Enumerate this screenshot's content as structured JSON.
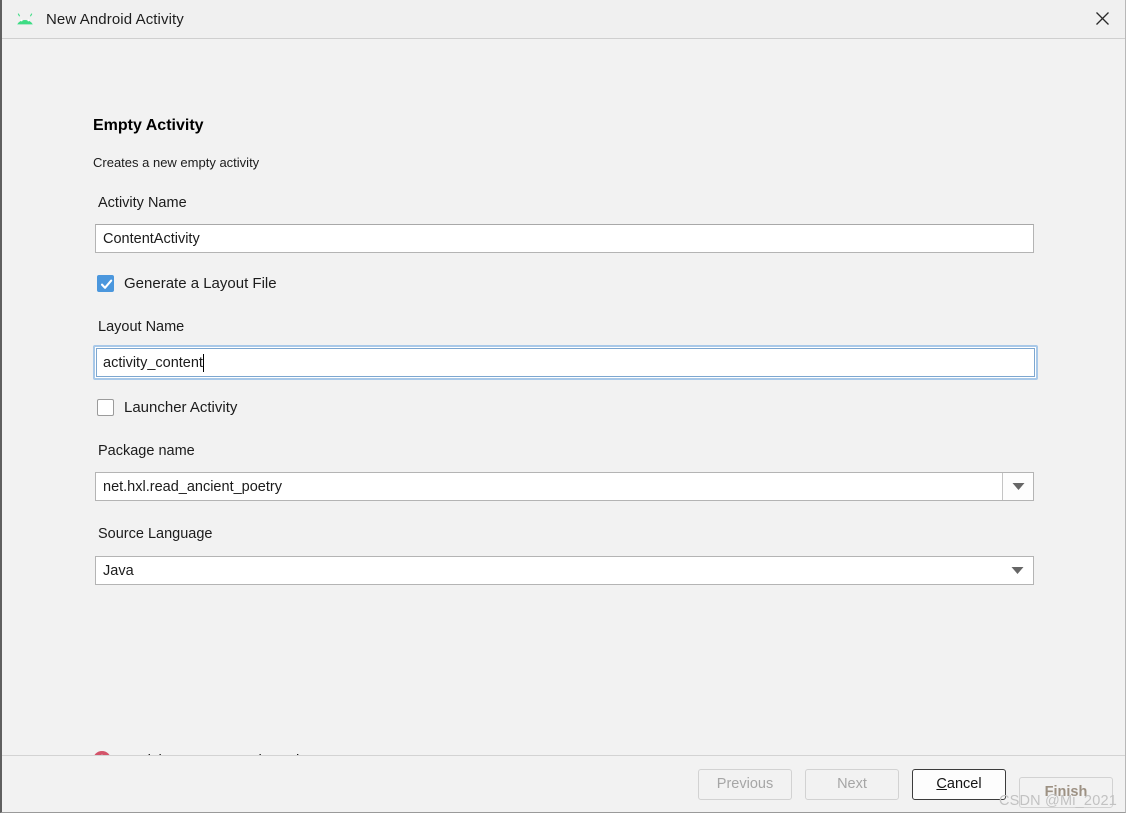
{
  "window": {
    "title": "New Android Activity",
    "app_icon": "android-robot-icon",
    "close_icon": "close-icon"
  },
  "header": {
    "title": "Empty Activity",
    "subtitle": "Creates a new empty activity"
  },
  "fields": {
    "activity_name": {
      "label": "Activity Name",
      "value": "ContentActivity",
      "focused": false
    },
    "generate_layout": {
      "label": "Generate a Layout File",
      "checked": true
    },
    "layout_name": {
      "label": "Layout Name",
      "value": "activity_content",
      "focused": true
    },
    "launcher_activity": {
      "label": "Launcher Activity",
      "checked": false
    },
    "package_name": {
      "label": "Package name",
      "value": "net.hxl.read_ancient_poetry",
      "dropdown_icon": "chevron-down-icon"
    },
    "source_language": {
      "label": "Source Language",
      "value": "Java",
      "dropdown_icon": "chevron-down-icon"
    }
  },
  "validation": {
    "icon": "error-circle-icon",
    "message": "Activity Name must be unique",
    "color": "#d3546a"
  },
  "footer": {
    "buttons": [
      {
        "label": "Previous",
        "state": "disabled"
      },
      {
        "label": "Next",
        "state": "disabled"
      },
      {
        "label": "Cancel",
        "state": "enabled",
        "mnemonic": "C"
      },
      {
        "label": "Finish",
        "state": "disabled"
      }
    ],
    "previous_label": "Previous",
    "next_label": "Next",
    "cancel_label_prefix": "",
    "cancel_mnemonic": "C",
    "cancel_label_suffix": "ancel",
    "finish_label": "Finish"
  },
  "watermark": "CSDN @Mi_2021",
  "colors": {
    "accent_blue": "#4b97dd",
    "android_green": "#3ddc84",
    "error_red": "#d3546a",
    "window_bg": "#f2f2f2"
  }
}
